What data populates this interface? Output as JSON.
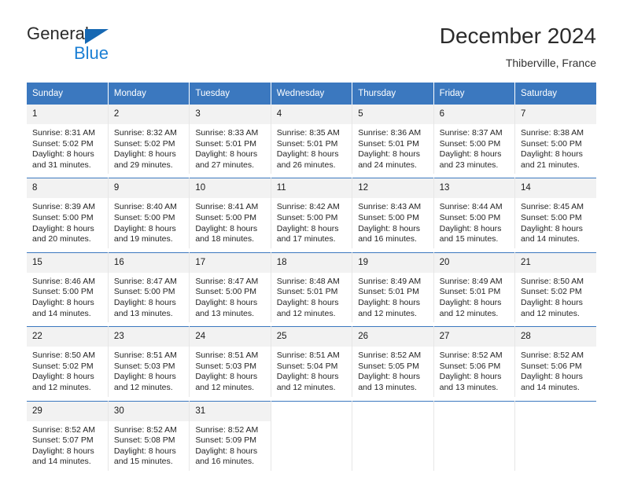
{
  "brand": {
    "name_part1": "General",
    "name_part2": "Blue",
    "triangle_color": "#1668b3",
    "blue_color": "#1b7fd4"
  },
  "header": {
    "title": "December 2024",
    "subtitle": "Thiberville, France"
  },
  "theme": {
    "header_bg": "#3b78bf",
    "header_text": "#ffffff",
    "daynum_bg": "#f2f2f2",
    "row_divider": "#3b78bf"
  },
  "weekdays": [
    "Sunday",
    "Monday",
    "Tuesday",
    "Wednesday",
    "Thursday",
    "Friday",
    "Saturday"
  ],
  "weeks": [
    [
      {
        "day": "1",
        "sunrise": "Sunrise: 8:31 AM",
        "sunset": "Sunset: 5:02 PM",
        "daylight1": "Daylight: 8 hours",
        "daylight2": "and 31 minutes."
      },
      {
        "day": "2",
        "sunrise": "Sunrise: 8:32 AM",
        "sunset": "Sunset: 5:02 PM",
        "daylight1": "Daylight: 8 hours",
        "daylight2": "and 29 minutes."
      },
      {
        "day": "3",
        "sunrise": "Sunrise: 8:33 AM",
        "sunset": "Sunset: 5:01 PM",
        "daylight1": "Daylight: 8 hours",
        "daylight2": "and 27 minutes."
      },
      {
        "day": "4",
        "sunrise": "Sunrise: 8:35 AM",
        "sunset": "Sunset: 5:01 PM",
        "daylight1": "Daylight: 8 hours",
        "daylight2": "and 26 minutes."
      },
      {
        "day": "5",
        "sunrise": "Sunrise: 8:36 AM",
        "sunset": "Sunset: 5:01 PM",
        "daylight1": "Daylight: 8 hours",
        "daylight2": "and 24 minutes."
      },
      {
        "day": "6",
        "sunrise": "Sunrise: 8:37 AM",
        "sunset": "Sunset: 5:00 PM",
        "daylight1": "Daylight: 8 hours",
        "daylight2": "and 23 minutes."
      },
      {
        "day": "7",
        "sunrise": "Sunrise: 8:38 AM",
        "sunset": "Sunset: 5:00 PM",
        "daylight1": "Daylight: 8 hours",
        "daylight2": "and 21 minutes."
      }
    ],
    [
      {
        "day": "8",
        "sunrise": "Sunrise: 8:39 AM",
        "sunset": "Sunset: 5:00 PM",
        "daylight1": "Daylight: 8 hours",
        "daylight2": "and 20 minutes."
      },
      {
        "day": "9",
        "sunrise": "Sunrise: 8:40 AM",
        "sunset": "Sunset: 5:00 PM",
        "daylight1": "Daylight: 8 hours",
        "daylight2": "and 19 minutes."
      },
      {
        "day": "10",
        "sunrise": "Sunrise: 8:41 AM",
        "sunset": "Sunset: 5:00 PM",
        "daylight1": "Daylight: 8 hours",
        "daylight2": "and 18 minutes."
      },
      {
        "day": "11",
        "sunrise": "Sunrise: 8:42 AM",
        "sunset": "Sunset: 5:00 PM",
        "daylight1": "Daylight: 8 hours",
        "daylight2": "and 17 minutes."
      },
      {
        "day": "12",
        "sunrise": "Sunrise: 8:43 AM",
        "sunset": "Sunset: 5:00 PM",
        "daylight1": "Daylight: 8 hours",
        "daylight2": "and 16 minutes."
      },
      {
        "day": "13",
        "sunrise": "Sunrise: 8:44 AM",
        "sunset": "Sunset: 5:00 PM",
        "daylight1": "Daylight: 8 hours",
        "daylight2": "and 15 minutes."
      },
      {
        "day": "14",
        "sunrise": "Sunrise: 8:45 AM",
        "sunset": "Sunset: 5:00 PM",
        "daylight1": "Daylight: 8 hours",
        "daylight2": "and 14 minutes."
      }
    ],
    [
      {
        "day": "15",
        "sunrise": "Sunrise: 8:46 AM",
        "sunset": "Sunset: 5:00 PM",
        "daylight1": "Daylight: 8 hours",
        "daylight2": "and 14 minutes."
      },
      {
        "day": "16",
        "sunrise": "Sunrise: 8:47 AM",
        "sunset": "Sunset: 5:00 PM",
        "daylight1": "Daylight: 8 hours",
        "daylight2": "and 13 minutes."
      },
      {
        "day": "17",
        "sunrise": "Sunrise: 8:47 AM",
        "sunset": "Sunset: 5:00 PM",
        "daylight1": "Daylight: 8 hours",
        "daylight2": "and 13 minutes."
      },
      {
        "day": "18",
        "sunrise": "Sunrise: 8:48 AM",
        "sunset": "Sunset: 5:01 PM",
        "daylight1": "Daylight: 8 hours",
        "daylight2": "and 12 minutes."
      },
      {
        "day": "19",
        "sunrise": "Sunrise: 8:49 AM",
        "sunset": "Sunset: 5:01 PM",
        "daylight1": "Daylight: 8 hours",
        "daylight2": "and 12 minutes."
      },
      {
        "day": "20",
        "sunrise": "Sunrise: 8:49 AM",
        "sunset": "Sunset: 5:01 PM",
        "daylight1": "Daylight: 8 hours",
        "daylight2": "and 12 minutes."
      },
      {
        "day": "21",
        "sunrise": "Sunrise: 8:50 AM",
        "sunset": "Sunset: 5:02 PM",
        "daylight1": "Daylight: 8 hours",
        "daylight2": "and 12 minutes."
      }
    ],
    [
      {
        "day": "22",
        "sunrise": "Sunrise: 8:50 AM",
        "sunset": "Sunset: 5:02 PM",
        "daylight1": "Daylight: 8 hours",
        "daylight2": "and 12 minutes."
      },
      {
        "day": "23",
        "sunrise": "Sunrise: 8:51 AM",
        "sunset": "Sunset: 5:03 PM",
        "daylight1": "Daylight: 8 hours",
        "daylight2": "and 12 minutes."
      },
      {
        "day": "24",
        "sunrise": "Sunrise: 8:51 AM",
        "sunset": "Sunset: 5:03 PM",
        "daylight1": "Daylight: 8 hours",
        "daylight2": "and 12 minutes."
      },
      {
        "day": "25",
        "sunrise": "Sunrise: 8:51 AM",
        "sunset": "Sunset: 5:04 PM",
        "daylight1": "Daylight: 8 hours",
        "daylight2": "and 12 minutes."
      },
      {
        "day": "26",
        "sunrise": "Sunrise: 8:52 AM",
        "sunset": "Sunset: 5:05 PM",
        "daylight1": "Daylight: 8 hours",
        "daylight2": "and 13 minutes."
      },
      {
        "day": "27",
        "sunrise": "Sunrise: 8:52 AM",
        "sunset": "Sunset: 5:06 PM",
        "daylight1": "Daylight: 8 hours",
        "daylight2": "and 13 minutes."
      },
      {
        "day": "28",
        "sunrise": "Sunrise: 8:52 AM",
        "sunset": "Sunset: 5:06 PM",
        "daylight1": "Daylight: 8 hours",
        "daylight2": "and 14 minutes."
      }
    ],
    [
      {
        "day": "29",
        "sunrise": "Sunrise: 8:52 AM",
        "sunset": "Sunset: 5:07 PM",
        "daylight1": "Daylight: 8 hours",
        "daylight2": "and 14 minutes."
      },
      {
        "day": "30",
        "sunrise": "Sunrise: 8:52 AM",
        "sunset": "Sunset: 5:08 PM",
        "daylight1": "Daylight: 8 hours",
        "daylight2": "and 15 minutes."
      },
      {
        "day": "31",
        "sunrise": "Sunrise: 8:52 AM",
        "sunset": "Sunset: 5:09 PM",
        "daylight1": "Daylight: 8 hours",
        "daylight2": "and 16 minutes."
      },
      {
        "day": "",
        "sunrise": "",
        "sunset": "",
        "daylight1": "",
        "daylight2": ""
      },
      {
        "day": "",
        "sunrise": "",
        "sunset": "",
        "daylight1": "",
        "daylight2": ""
      },
      {
        "day": "",
        "sunrise": "",
        "sunset": "",
        "daylight1": "",
        "daylight2": ""
      },
      {
        "day": "",
        "sunrise": "",
        "sunset": "",
        "daylight1": "",
        "daylight2": ""
      }
    ]
  ]
}
